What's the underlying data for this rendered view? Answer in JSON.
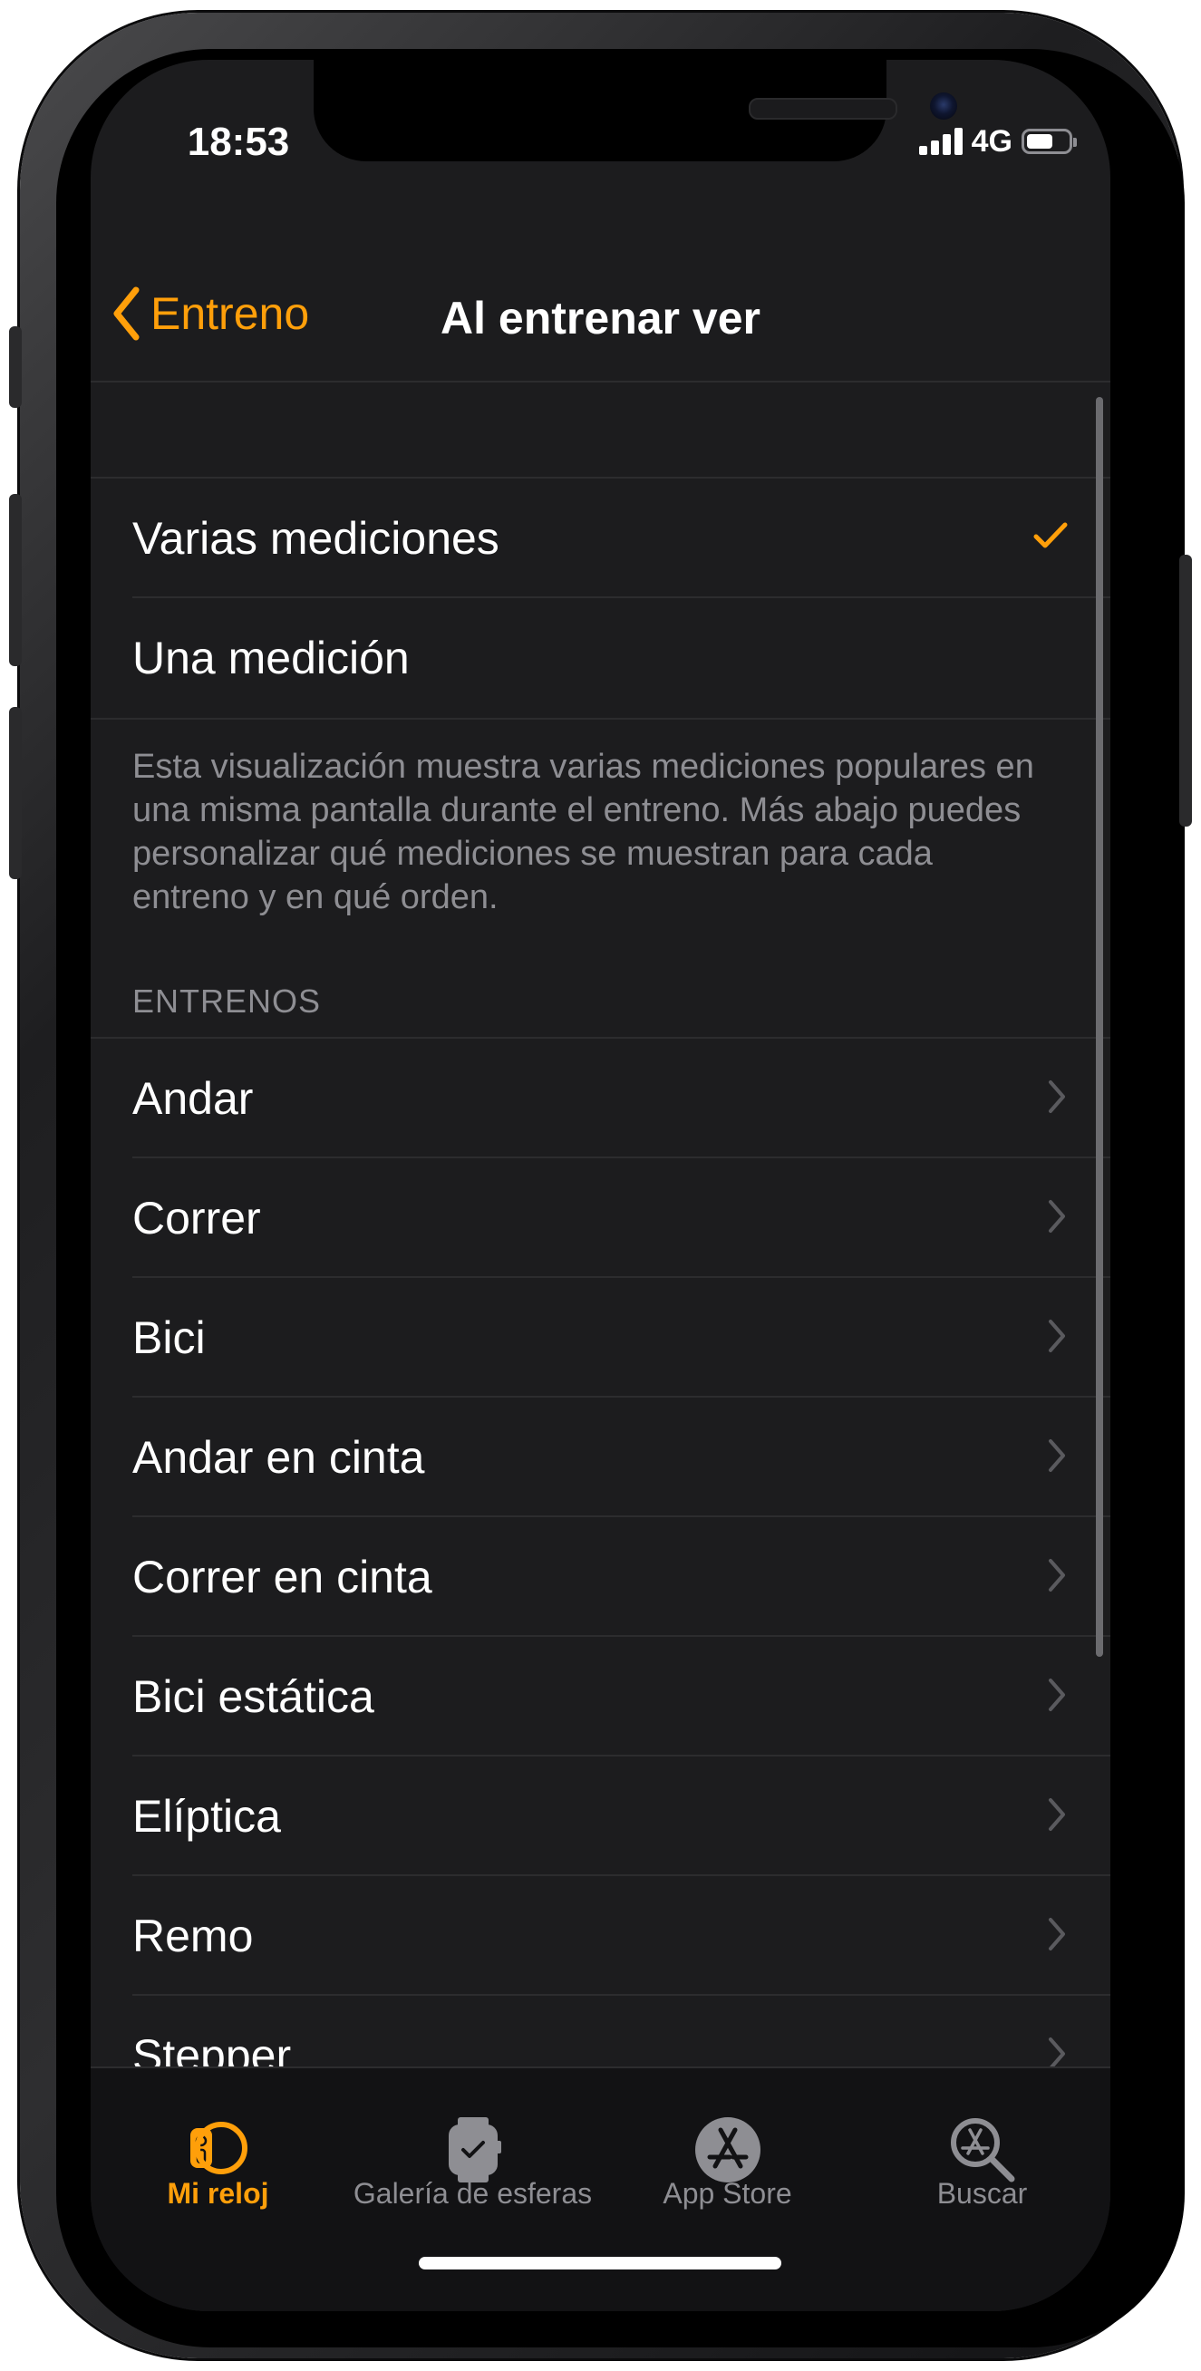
{
  "status_bar": {
    "time": "18:53",
    "network": "4G"
  },
  "nav": {
    "back_label": "Entreno",
    "title": "Al entrenar ver"
  },
  "view_mode": {
    "options": [
      {
        "label": "Varias mediciones",
        "selected": true
      },
      {
        "label": "Una medición",
        "selected": false
      }
    ],
    "description": "Esta visualización muestra varias mediciones populares en una misma pantalla durante el entreno. Más abajo puedes personalizar qué mediciones se muestran para cada entreno y en qué orden."
  },
  "workouts": {
    "header": "ENTRENOS",
    "items": [
      "Andar",
      "Correr",
      "Bici",
      "Andar en cinta",
      "Correr en cinta",
      "Bici estática",
      "Elíptica",
      "Remo",
      "Stepper"
    ]
  },
  "tabbar": {
    "tabs": [
      {
        "label": "Mi reloj",
        "icon": "watch-icon",
        "active": true
      },
      {
        "label": "Galería de esferas",
        "icon": "watch-face-gallery-icon",
        "active": false
      },
      {
        "label": "App Store",
        "icon": "app-store-icon",
        "active": false
      },
      {
        "label": "Buscar",
        "icon": "search-icon",
        "active": false
      }
    ]
  },
  "colors": {
    "accent": "#ff9f0a",
    "background": "#1c1c1e",
    "separator": "#2c2c2e",
    "secondary_text": "#8e8e93"
  }
}
